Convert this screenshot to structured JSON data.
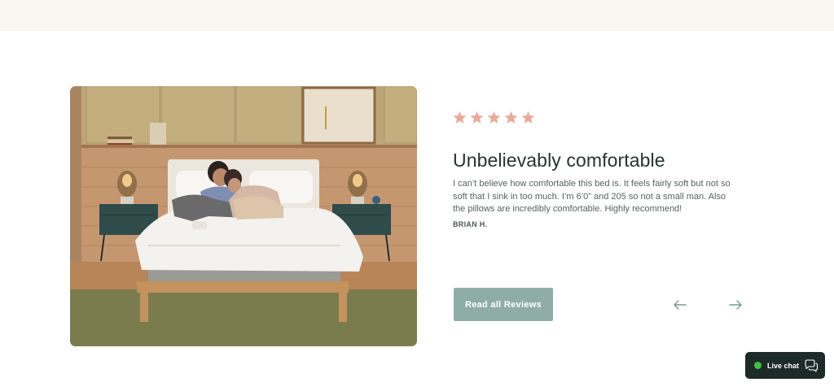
{
  "review": {
    "rating": 5,
    "title": "Unbelievably comfortable",
    "body": "I can’t believe how comfortable this bed is. It feels fairly soft but not so soft that I sink in too much. I’m 6’0” and 205 so not a small man. Also the pillows are incredibly comfortable. Highly recommend!",
    "author": "BRIAN H."
  },
  "cta": {
    "read_all_label": "Read all Reviews"
  },
  "carousel": {
    "prev_icon": "arrow-left-icon",
    "next_icon": "arrow-right-icon"
  },
  "live_chat": {
    "label": "Live chat",
    "status_color": "#3cc246",
    "icon": "chat-bubbles-icon"
  },
  "colors": {
    "star": "#e6ab9c",
    "button_bg": "#8eaea5",
    "heading": "#27332f",
    "body_text": "#57625e",
    "top_band": "#f8f6f1",
    "chat_bg": "#1d2b28"
  }
}
